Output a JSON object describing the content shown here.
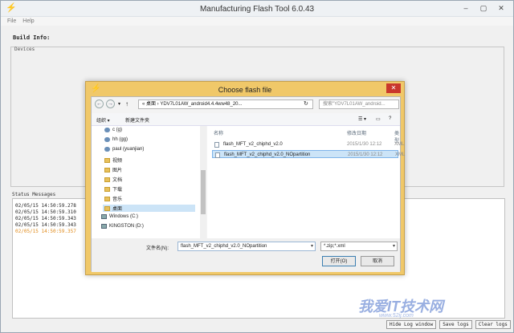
{
  "app": {
    "title": "Manufacturing Flash Tool 6.0.43",
    "menu": [
      "File",
      "Help"
    ],
    "window_buttons": [
      "–",
      "▢",
      "✕"
    ]
  },
  "main": {
    "build_info_label": "Build Info:",
    "devices_label": "Devices",
    "status_label": "Status Messages",
    "logs": [
      {
        "text": "02/05/15 14:50:59.278",
        "color": "#222222"
      },
      {
        "text": "02/05/15 14:50:59.310",
        "color": "#222222"
      },
      {
        "text": "02/05/15 14:50:59.343",
        "color": "#222222"
      },
      {
        "text": "02/05/15 14:50:59.343",
        "color": "#222222"
      },
      {
        "text": "02/05/15 14:50:59.357",
        "color": "#e08a1a"
      }
    ],
    "buttons": [
      "Hide Log window",
      "Save logs",
      "Clear logs"
    ]
  },
  "dialog": {
    "title": "Choose flash file",
    "close": "✕",
    "address": "« 桌面  ›  YDV7L01AW_android4.4.4ww48_20...",
    "search_placeholder": "搜索\"YDV7L01AW_android...",
    "organize": "组织 ▾",
    "new_folder": "新建文件夹",
    "tree": [
      {
        "label": "c (g)",
        "icon": "person"
      },
      {
        "label": "hh (gg)",
        "icon": "person"
      },
      {
        "label": "paul (yuanjian)",
        "icon": "person"
      },
      {
        "label": "视频",
        "icon": "folder"
      },
      {
        "label": "图片",
        "icon": "folder"
      },
      {
        "label": "文档",
        "icon": "folder"
      },
      {
        "label": "下载",
        "icon": "folder"
      },
      {
        "label": "音乐",
        "icon": "folder"
      },
      {
        "label": "桌面",
        "icon": "folder",
        "selected": true
      },
      {
        "label": "Windows (C:)",
        "icon": "drive"
      },
      {
        "label": "KINGSTON (D:)",
        "icon": "drive"
      }
    ],
    "columns": {
      "name": "名称",
      "date": "修改日期",
      "type": "类型"
    },
    "files": [
      {
        "name": "flash_MFT_v2_chiphd_v2.0",
        "date": "2015/1/30 12:12",
        "type": "XML"
      },
      {
        "name": "flash_MFT_v2_chiphd_v2.0_NOpartition",
        "date": "2015/1/30 12:12",
        "type": "XML",
        "selected": true
      }
    ],
    "filename_label": "文件名(N):",
    "filename_value": "flash_MFT_v2_chiphd_v2.0_NOpartition",
    "filter": "*.zip;*.xml",
    "open_button": "打开(O)",
    "cancel_button": "取消"
  },
  "watermark": {
    "text": "我爱IT技术网",
    "sub": "www.52ij.com"
  }
}
